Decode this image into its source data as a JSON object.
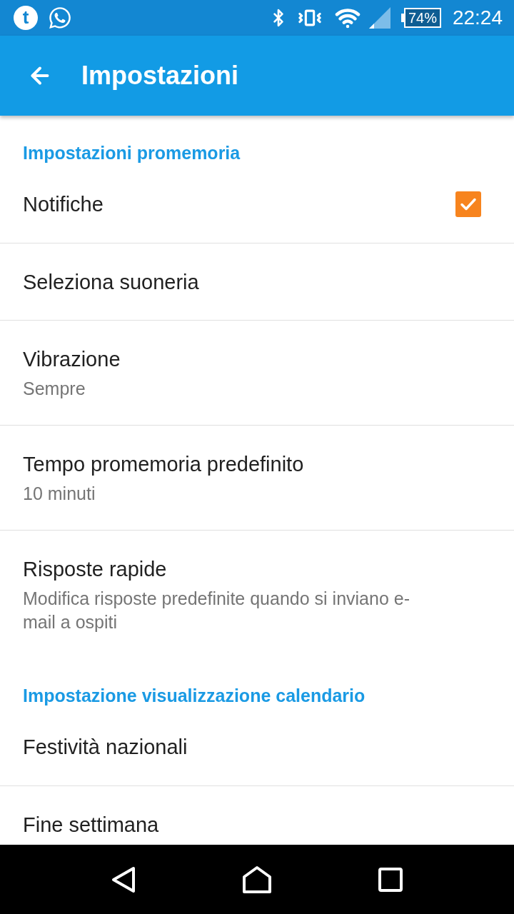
{
  "status_bar": {
    "notifications": [
      {
        "kind": "letter",
        "glyph": "t"
      },
      {
        "kind": "phone"
      }
    ],
    "battery": "74%",
    "time": "22:24"
  },
  "app_bar": {
    "title": "Impostazioni"
  },
  "sections": [
    {
      "title": "Impostazioni promemoria",
      "items": [
        {
          "kind": "checkbox",
          "title": "Notifiche",
          "checked": true
        },
        {
          "kind": "text",
          "title": "Seleziona suoneria"
        },
        {
          "kind": "text",
          "title": "Vibrazione",
          "summary": "Sempre"
        },
        {
          "kind": "text",
          "title": "Tempo promemoria predefinito",
          "summary": "10 minuti"
        },
        {
          "kind": "text",
          "title": "Risposte rapide",
          "summary": "Modifica risposte predefinite quando si inviano e-mail a ospiti"
        }
      ]
    },
    {
      "title": "Impostazione visualizzazione calendario",
      "items": [
        {
          "kind": "text",
          "title": "Festività nazionali"
        },
        {
          "kind": "text",
          "title": "Fine settimana"
        }
      ]
    }
  ]
}
